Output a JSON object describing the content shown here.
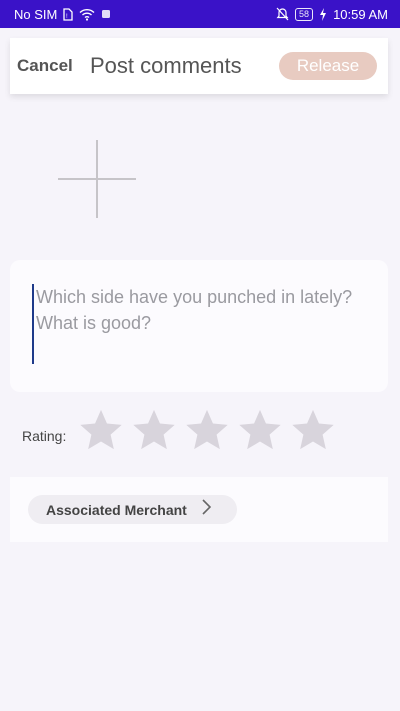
{
  "status_bar": {
    "carrier": "No SIM",
    "battery": "58",
    "time": "10:59 AM",
    "icons": [
      "sim-icon",
      "wifi-icon",
      "notification-icon",
      "bell-off-icon",
      "battery-icon",
      "charging-icon"
    ]
  },
  "header": {
    "cancel_label": "Cancel",
    "title": "Post comments",
    "release_label": "Release"
  },
  "add_image": {
    "icon": "plus-icon"
  },
  "comment": {
    "placeholder": "Which side have you punched in lately? What is good?",
    "value": ""
  },
  "rating": {
    "label": "Rating:",
    "max": 5,
    "value": 0,
    "star_color": "#d8d4dc"
  },
  "merchant": {
    "label": "Associated Merchant",
    "icon": "chevron-right-icon"
  },
  "colors": {
    "status_bar": "#3a12c8",
    "release_button": "#e8cbc1",
    "background": "#f6f4fa"
  }
}
